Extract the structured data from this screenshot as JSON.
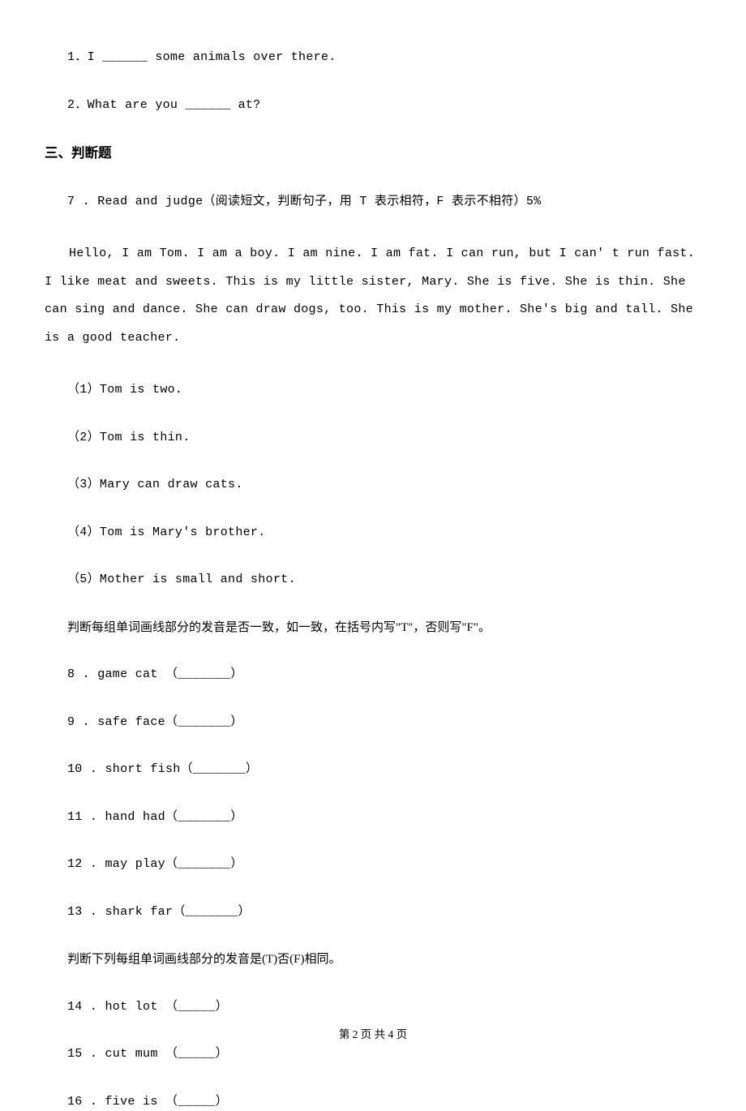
{
  "fill": {
    "q1": "1．I ______ some animals over there.",
    "q2": "2．What are you ______ at?"
  },
  "section3": {
    "heading": "三、判断题",
    "q7_lead": "7 . Read and judge（阅读短文，判断句子，用 T 表示相符，F 表示不相符）5%",
    "passage": "Hello, I am Tom. I am a boy. I am nine. I am fat. I can run, but I can' t run fast. I like meat and sweets. This is my little sister, Mary. She is five. She is thin. She can sing and dance. She can draw dogs, too. This is my mother. She's big and tall. She is a good teacher.",
    "s1": "（1）Tom is two.",
    "s2": "（2）Tom is thin.",
    "s3": "（3）Mary can draw cats.",
    "s4": "（4）Tom is Mary's brother.",
    "s5": "（5）Mother is small and short.",
    "instr_a": "判断每组单词画线部分的发音是否一致，如一致，在括号内写\"T\"，否则写\"F\"。",
    "i8": "8 . game      cat （_______）",
    "i9": "9 . safe     face（_______）",
    "i10": "10 . short      fish（_______）",
    "i11": "11 . hand      had（_______）",
    "i12": "12 . may      play（_______）",
    "i13": "13 . shark      far（_______）",
    "instr_b": "判断下列每组单词画线部分的发音是(T)否(F)相同。",
    "i14": "14 . hot         lot    （_____）",
    "i15": "15 . cut         mum    （_____）",
    "i16": "16 . five       is    （_____）"
  },
  "footer": "第 2 页 共 4 页"
}
